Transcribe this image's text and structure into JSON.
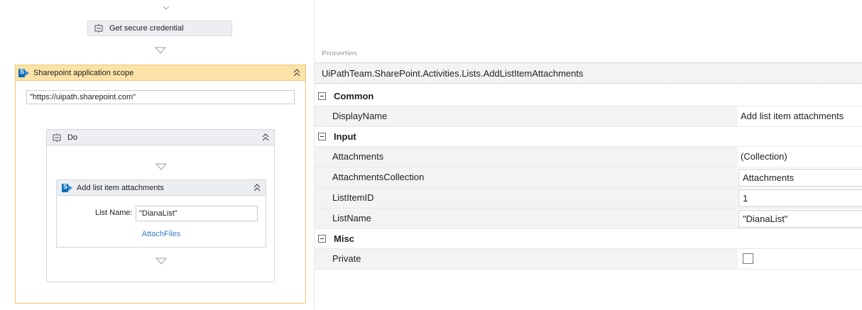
{
  "designer": {
    "credential_activity": "Get secure credential",
    "scope": {
      "title": "Sharepoint application scope",
      "url_value": "\"https://uipath.sharepoint.com\""
    },
    "do_sequence": {
      "title": "Do"
    },
    "attach_activity": {
      "title": "Add list item attachments",
      "list_name_label": "List Name:",
      "list_name_value": "\"DianaList\"",
      "link_label": "AttachFiles"
    }
  },
  "properties": {
    "panel_title": "Properties",
    "type_name": "UiPathTeam.SharePoint.Activities.Lists.AddListItemAttachments",
    "categories": {
      "common": {
        "label": "Common",
        "rows": [
          {
            "name": "DisplayName",
            "value": "Add list item attachments"
          }
        ]
      },
      "input": {
        "label": "Input",
        "rows": [
          {
            "name": "Attachments",
            "value": "(Collection)"
          },
          {
            "name": "AttachmentsCollection",
            "value": "Attachments"
          },
          {
            "name": "ListItemID",
            "value": "1"
          },
          {
            "name": "ListName",
            "value": "\"DianaList\""
          }
        ]
      },
      "misc": {
        "label": "Misc",
        "rows": [
          {
            "name": "Private",
            "checked": false
          }
        ]
      }
    }
  },
  "colors": {
    "scope_header": "#fbe3a8",
    "scope_border": "#f0c674",
    "link": "#3c7bc8",
    "sharepoint_blue": "#0b6fb8"
  }
}
